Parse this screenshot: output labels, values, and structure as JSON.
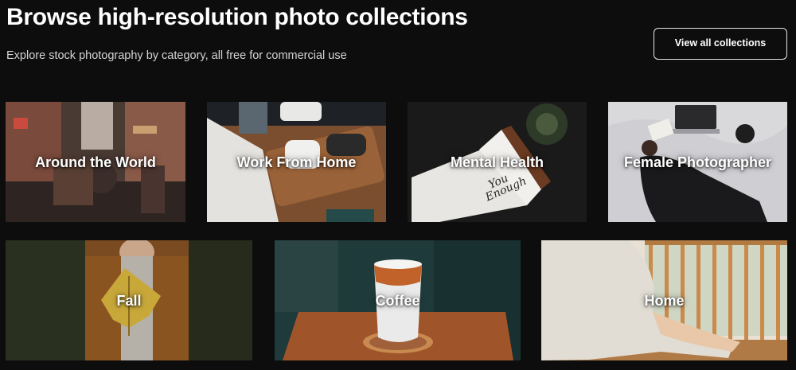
{
  "header": {
    "title": "Browse high-resolution photo collections",
    "subtitle": "Explore stock photography by category, all free for commercial use",
    "view_all_label": "View all collections"
  },
  "collections": [
    {
      "label": "Around the World",
      "icon": "street-photo"
    },
    {
      "label": "Work From Home",
      "icon": "desk-photo"
    },
    {
      "label": "Mental Health",
      "icon": "notebook-photo",
      "image_text": "You Enough"
    },
    {
      "label": "Female Photographer",
      "icon": "laptop-bed-photo"
    },
    {
      "label": "Fall",
      "icon": "autumn-leaf-photo"
    },
    {
      "label": "Coffee",
      "icon": "iced-coffee-photo"
    },
    {
      "label": "Home",
      "icon": "window-sitting-photo"
    }
  ]
}
